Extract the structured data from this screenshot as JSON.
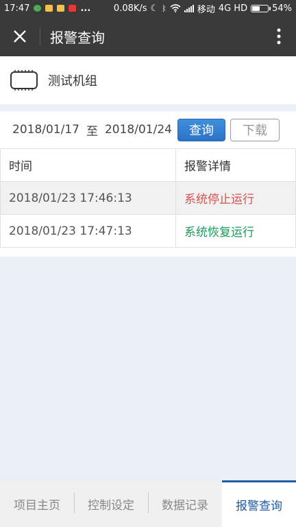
{
  "statusbar": {
    "time": "17:47",
    "more": "...",
    "net_speed": "0.08K/s",
    "carrier": "移动",
    "network": "4G HD",
    "battery": "54%",
    "battery_level": 0.54
  },
  "appbar": {
    "title": "报警查询"
  },
  "device": {
    "name": "测试机组"
  },
  "query": {
    "start_date": "2018/01/17",
    "separator": "至",
    "end_date": "2018/01/24",
    "query_label": "查询",
    "download_label": "下载"
  },
  "table": {
    "headers": [
      "时间",
      "报警详情"
    ],
    "rows": [
      {
        "time": "2018/01/23 17:46:13",
        "detail": "系统停止运行",
        "detail_color": "#d9534f"
      },
      {
        "time": "2018/01/23 17:47:13",
        "detail": "系统恢复运行",
        "detail_color": "#1a9a5c"
      }
    ]
  },
  "tabs": [
    {
      "label": "项目主页",
      "active": false
    },
    {
      "label": "控制设定",
      "active": false
    },
    {
      "label": "数据记录",
      "active": false
    },
    {
      "label": "报警查询",
      "active": true
    }
  ]
}
